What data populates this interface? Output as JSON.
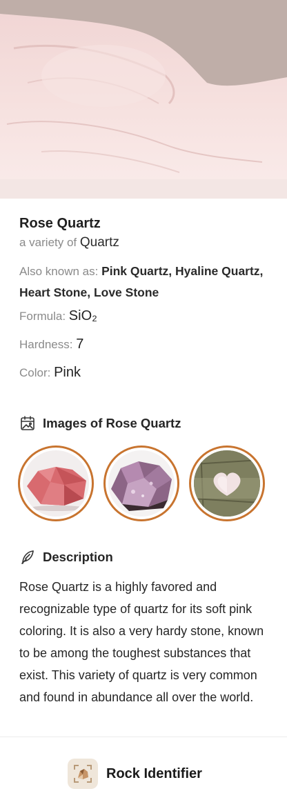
{
  "hero": {
    "image": "rose-quartz-photo"
  },
  "specimen": {
    "title": "Rose Quartz",
    "variety_prefix": "a variety of ",
    "variety_parent": "Quartz",
    "aka_label": "Also known as: ",
    "aka_value": "Pink Quartz, Hyaline Quartz, Heart Stone, Love Stone",
    "formula_label": "Formula: ",
    "formula_value": "SiO₂",
    "hardness_label": "Hardness: ",
    "hardness_value": "7",
    "color_label": "Color: ",
    "color_value": "Pink"
  },
  "images_section": {
    "label": "Images of Rose Quartz",
    "icon": "gallery-icon",
    "thumbnails": [
      "rose-quartz-rough",
      "rose-quartz-purple-rough",
      "rose-quartz-heart"
    ],
    "ring_color": "#c8742f"
  },
  "description_section": {
    "label": "Description",
    "icon": "feather-icon",
    "text": "Rose Quartz is a highly favored and recognizable type of quartz for its soft pink coloring. It is also a very hardy stone, known to be among the toughest substances that exist. This variety of quartz is very common and found in abundance all over the world."
  },
  "footer": {
    "brand": "Rock Identifier",
    "icon": "rock-identifier-logo-icon"
  }
}
